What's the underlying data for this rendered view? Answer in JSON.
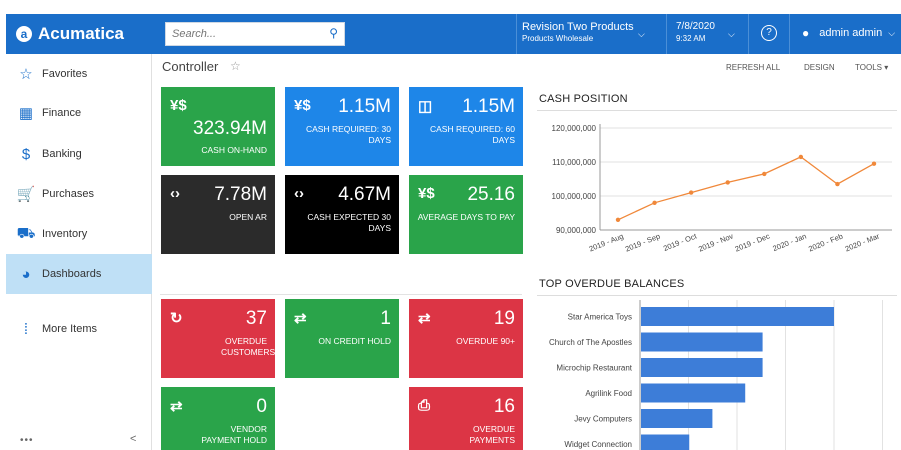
{
  "app": {
    "name": "Acumatica"
  },
  "search": {
    "placeholder": "Search..."
  },
  "company": {
    "name": "Revision Two Products",
    "branch": "Products Wholesale"
  },
  "date": {
    "date": "7/8/2020",
    "time": "9:32 AM"
  },
  "user": {
    "name": "admin admin"
  },
  "sidebar": {
    "items": [
      {
        "label": "Favorites",
        "icon": "star-icon"
      },
      {
        "label": "Finance",
        "icon": "calculator-icon"
      },
      {
        "label": "Banking",
        "icon": "dollar-icon"
      },
      {
        "label": "Purchases",
        "icon": "cart-icon"
      },
      {
        "label": "Inventory",
        "icon": "truck-icon"
      },
      {
        "label": "Dashboards",
        "icon": "gauge-icon"
      },
      {
        "label": "More Items",
        "icon": "grid-icon"
      }
    ],
    "dots": "•••",
    "collapse": "<"
  },
  "page": {
    "title": "Controller"
  },
  "actions": {
    "refresh": "REFRESH ALL",
    "design": "DESIGN",
    "tools": "TOOLS"
  },
  "tiles": [
    {
      "value": "323.94M",
      "label": "CASH ON-HAND",
      "icon": "yen-dollar-icon",
      "color": "#2aa44a"
    },
    {
      "value": "1.15M",
      "label": "CASH REQUIRED: 30 DAYS",
      "icon": "yen-dollar-icon",
      "color": "#1e86e8"
    },
    {
      "value": "1.15M",
      "label": "CASH REQUIRED: 60 DAYS",
      "icon": "document-icon",
      "color": "#1e86e8"
    },
    {
      "value": "7.78M",
      "label": "OPEN AR",
      "icon": "code-icon",
      "color": "#2b2b2b"
    },
    {
      "value": "4.67M",
      "label": "CASH EXPECTED 30 DAYS",
      "icon": "code-icon",
      "color": "#000000"
    },
    {
      "value": "25.16",
      "label": "AVERAGE DAYS TO PAY",
      "icon": "yen-dollar-icon",
      "color": "#2aa44a"
    },
    {
      "value": "37",
      "label": "OVERDUE CUSTOMERS",
      "icon": "refresh-icon",
      "color": "#dc3545"
    },
    {
      "value": "1",
      "label": "ON CREDIT HOLD",
      "icon": "swap-icon",
      "color": "#2aa44a"
    },
    {
      "value": "19",
      "label": "OVERDUE 90+",
      "icon": "swap-icon",
      "color": "#dc3545"
    },
    {
      "value": "0",
      "label": "VENDOR PAYMENT HOLD",
      "icon": "swap-icon",
      "color": "#2aa44a"
    },
    {
      "value": "16",
      "label": "OVERDUE PAYMENTS",
      "icon": "clipboard-icon",
      "color": "#dc3545"
    }
  ],
  "cash_position": {
    "title": "CASH POSITION"
  },
  "overdue": {
    "title": "TOP OVERDUE BALANCES"
  },
  "chart_data": [
    {
      "type": "line",
      "title": "CASH POSITION",
      "categories": [
        "2019 - Aug",
        "2019 - Sep",
        "2019 - Oct",
        "2019 - Nov",
        "2019 - Dec",
        "2020 - Jan",
        "2020 - Feb",
        "2020 - Mar"
      ],
      "series": [
        {
          "values": [
            93000000,
            98000000,
            101000000,
            104000000,
            106500000,
            111500000,
            103500000,
            109500000
          ]
        }
      ],
      "yticks": [
        "90,000,000",
        "100,000,000",
        "110,000,000",
        "120,000,000"
      ],
      "ylim": [
        90000000,
        120000000
      ],
      "color": "#f0883a",
      "grid": true
    },
    {
      "type": "bar",
      "orientation": "horizontal",
      "title": "TOP OVERDUE BALANCES",
      "categories": [
        "Star America Toys",
        "Church of The Apostles",
        "Microchip Restaurant",
        "Agrilink Food",
        "Jevy Computers",
        "Widget Connection"
      ],
      "values": [
        100,
        63,
        63,
        54,
        37,
        25
      ],
      "color": "#3d7dd8",
      "grid": true
    }
  ]
}
